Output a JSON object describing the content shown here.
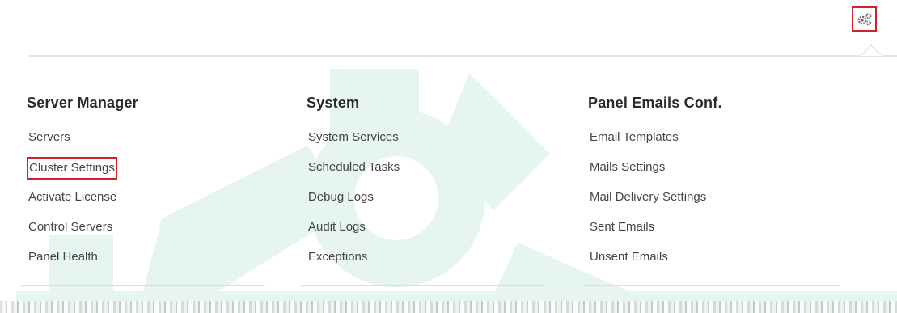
{
  "header": {
    "settings_icon": "gears-icon"
  },
  "menu": {
    "columns": [
      {
        "title": "Server Manager",
        "items": [
          "Servers",
          "Cluster Settings",
          "Activate License",
          "Control Servers",
          "Panel Health"
        ]
      },
      {
        "title": "System",
        "items": [
          "System Services",
          "Scheduled Tasks",
          "Debug Logs",
          "Audit Logs",
          "Exceptions"
        ]
      },
      {
        "title": "Panel Emails Conf.",
        "items": [
          "Email Templates",
          "Mails Settings",
          "Mail Delivery Settings",
          "Sent Emails",
          "Unsent Emails"
        ]
      }
    ]
  },
  "colors": {
    "highlight_border": "#d0202a",
    "watermark": "#e6f5f1",
    "heading_text": "#2b2b2b",
    "item_text": "#444444"
  }
}
